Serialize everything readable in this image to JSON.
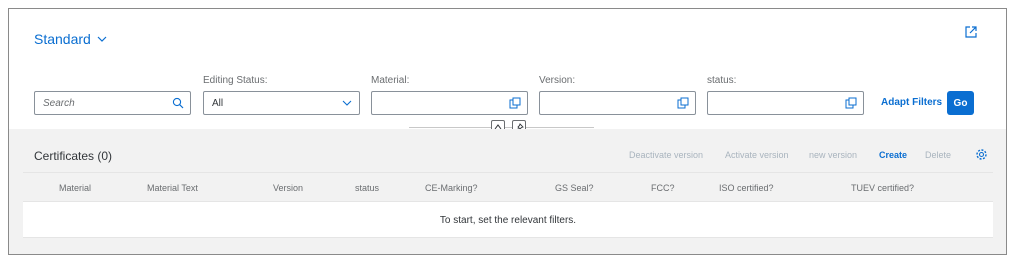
{
  "header": {
    "variant_label": "Standard",
    "search": {
      "placeholder": "Search"
    },
    "filters": [
      {
        "label": "Editing Status:",
        "value": "All"
      },
      {
        "label": "Material:",
        "value": ""
      },
      {
        "label": "Version:",
        "value": ""
      },
      {
        "label": "status:",
        "value": ""
      }
    ],
    "adapt_filters": "Adapt Filters",
    "go": "Go"
  },
  "table": {
    "title": "Certificates (0)",
    "toolbar": [
      {
        "label": "Deactivate version",
        "enabled": false
      },
      {
        "label": "Activate version",
        "enabled": false
      },
      {
        "label": "new version",
        "enabled": false
      },
      {
        "label": "Create",
        "enabled": true
      },
      {
        "label": "Delete",
        "enabled": false
      }
    ],
    "columns": [
      "Material",
      "Material Text",
      "Version",
      "status",
      "CE-Marking?",
      "GS Seal?",
      "FCC?",
      "ISO certified?",
      "TUEV certified?"
    ],
    "empty_message": "To start, set the relevant filters."
  },
  "colors": {
    "accent": "#0a6ed1",
    "disabled": "#a9b4be",
    "text": "#32363a"
  }
}
